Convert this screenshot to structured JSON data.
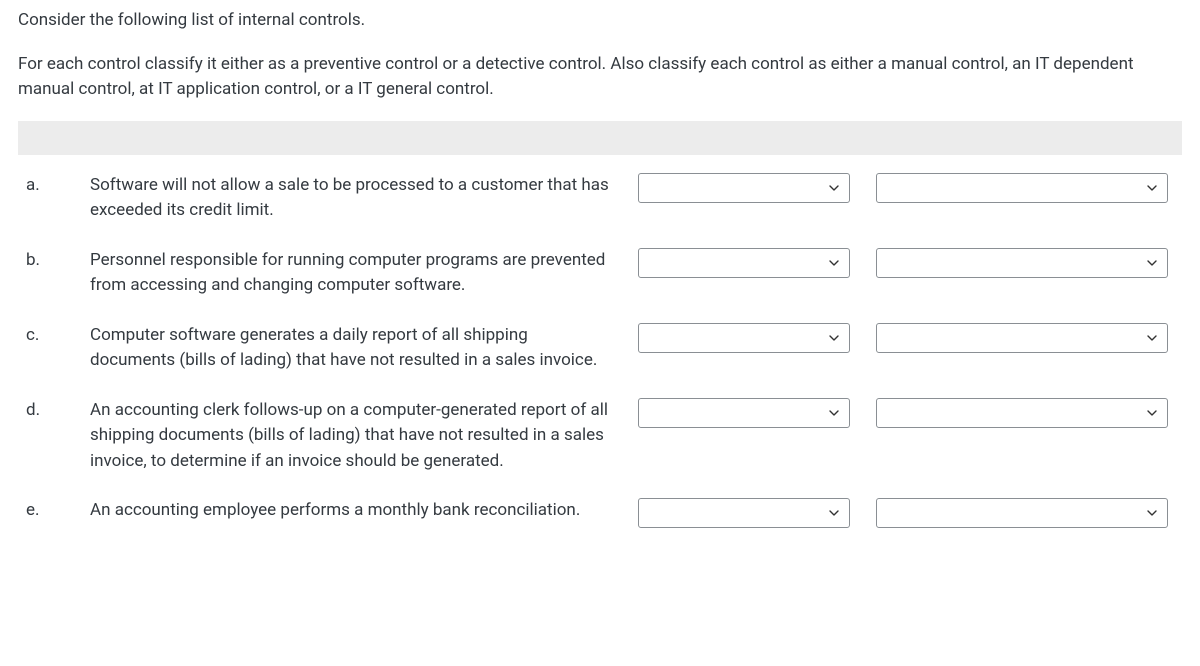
{
  "instructions": {
    "line1": "Consider the following list of internal controls.",
    "line2": "For each control classify it either as a preventive control or a detective control. Also classify each control as either a manual control, an IT dependent manual control, at IT application control, or a IT general control."
  },
  "items": [
    {
      "label": "a.",
      "text": "Software will not allow a sale to be processed to a customer that has exceeded its credit limit."
    },
    {
      "label": "b.",
      "text": "Personnel responsible for running computer programs are prevented from accessing and changing computer software."
    },
    {
      "label": "c.",
      "text": "Computer software generates a daily report of all shipping documents (bills of lading) that have not resulted in a sales invoice."
    },
    {
      "label": "d.",
      "text": "An accounting clerk follows-up on a computer-generated report of all shipping documents (bills of lading) that have not resulted in a sales invoice, to determine if an invoice should be generated."
    },
    {
      "label": "e.",
      "text": "An accounting employee performs a monthly bank reconciliation."
    }
  ]
}
